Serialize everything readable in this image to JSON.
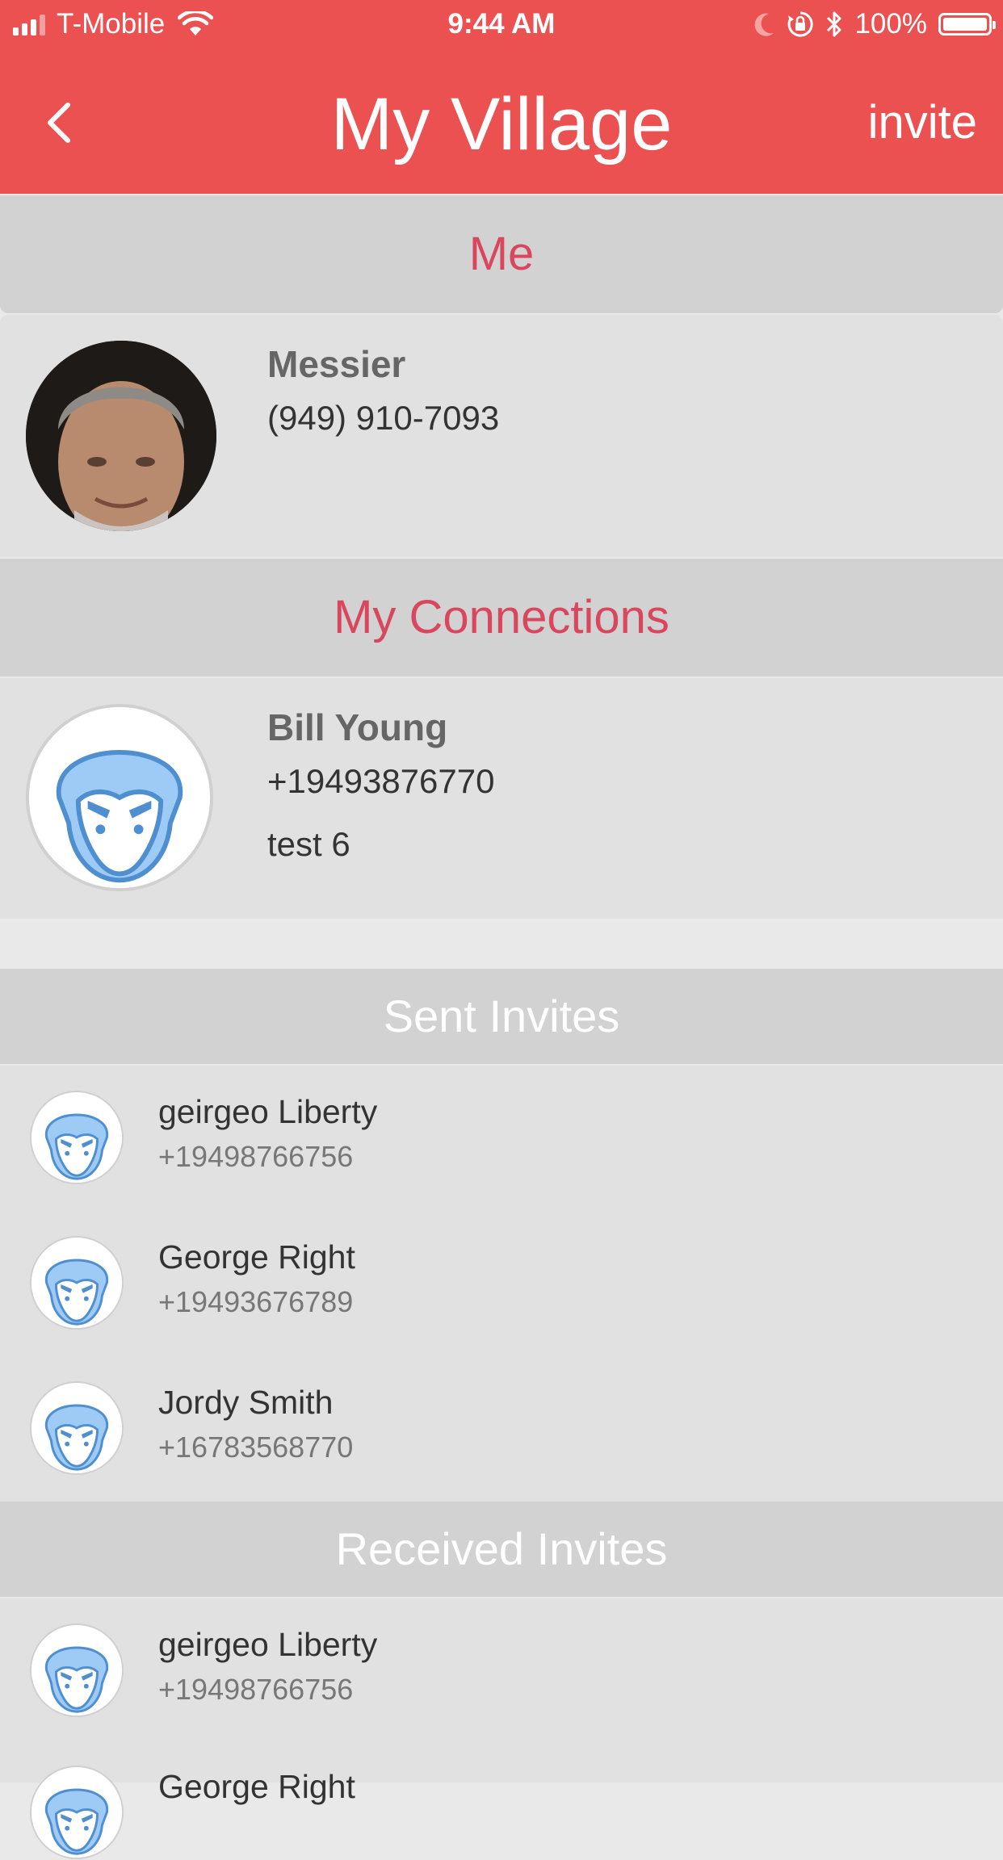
{
  "status_bar": {
    "carrier": "T-Mobile",
    "time": "9:44 AM",
    "battery": "100%",
    "icons": [
      "signal-icon",
      "wifi-icon",
      "moon-icon",
      "rotation-lock-icon",
      "bluetooth-icon",
      "battery-icon"
    ]
  },
  "nav": {
    "title": "My Village",
    "invite_label": "invite",
    "back_icon": "chevron-left-icon"
  },
  "colors": {
    "brand": "#ec5152",
    "section_title_red": "#d8475e",
    "avatar_blue": "#9ecbf5",
    "avatar_outline": "#4f8fd0"
  },
  "me": {
    "header": "Me",
    "name": "Messier",
    "phone": "(949) 910-7093"
  },
  "connections": {
    "header": "My Connections",
    "items": [
      {
        "name": "Bill Young",
        "phone": "+19493876770",
        "note": "test 6"
      }
    ]
  },
  "sent_invites": {
    "header": "Sent Invites",
    "items": [
      {
        "name": "geirgeo Liberty",
        "phone": "+19498766756"
      },
      {
        "name": "George Right",
        "phone": "+19493676789"
      },
      {
        "name": "Jordy Smith",
        "phone": "+16783568770"
      }
    ]
  },
  "received_invites": {
    "header": "Received Invites",
    "items": [
      {
        "name": "geirgeo Liberty",
        "phone": "+19498766756"
      },
      {
        "name": "George Right"
      }
    ]
  }
}
